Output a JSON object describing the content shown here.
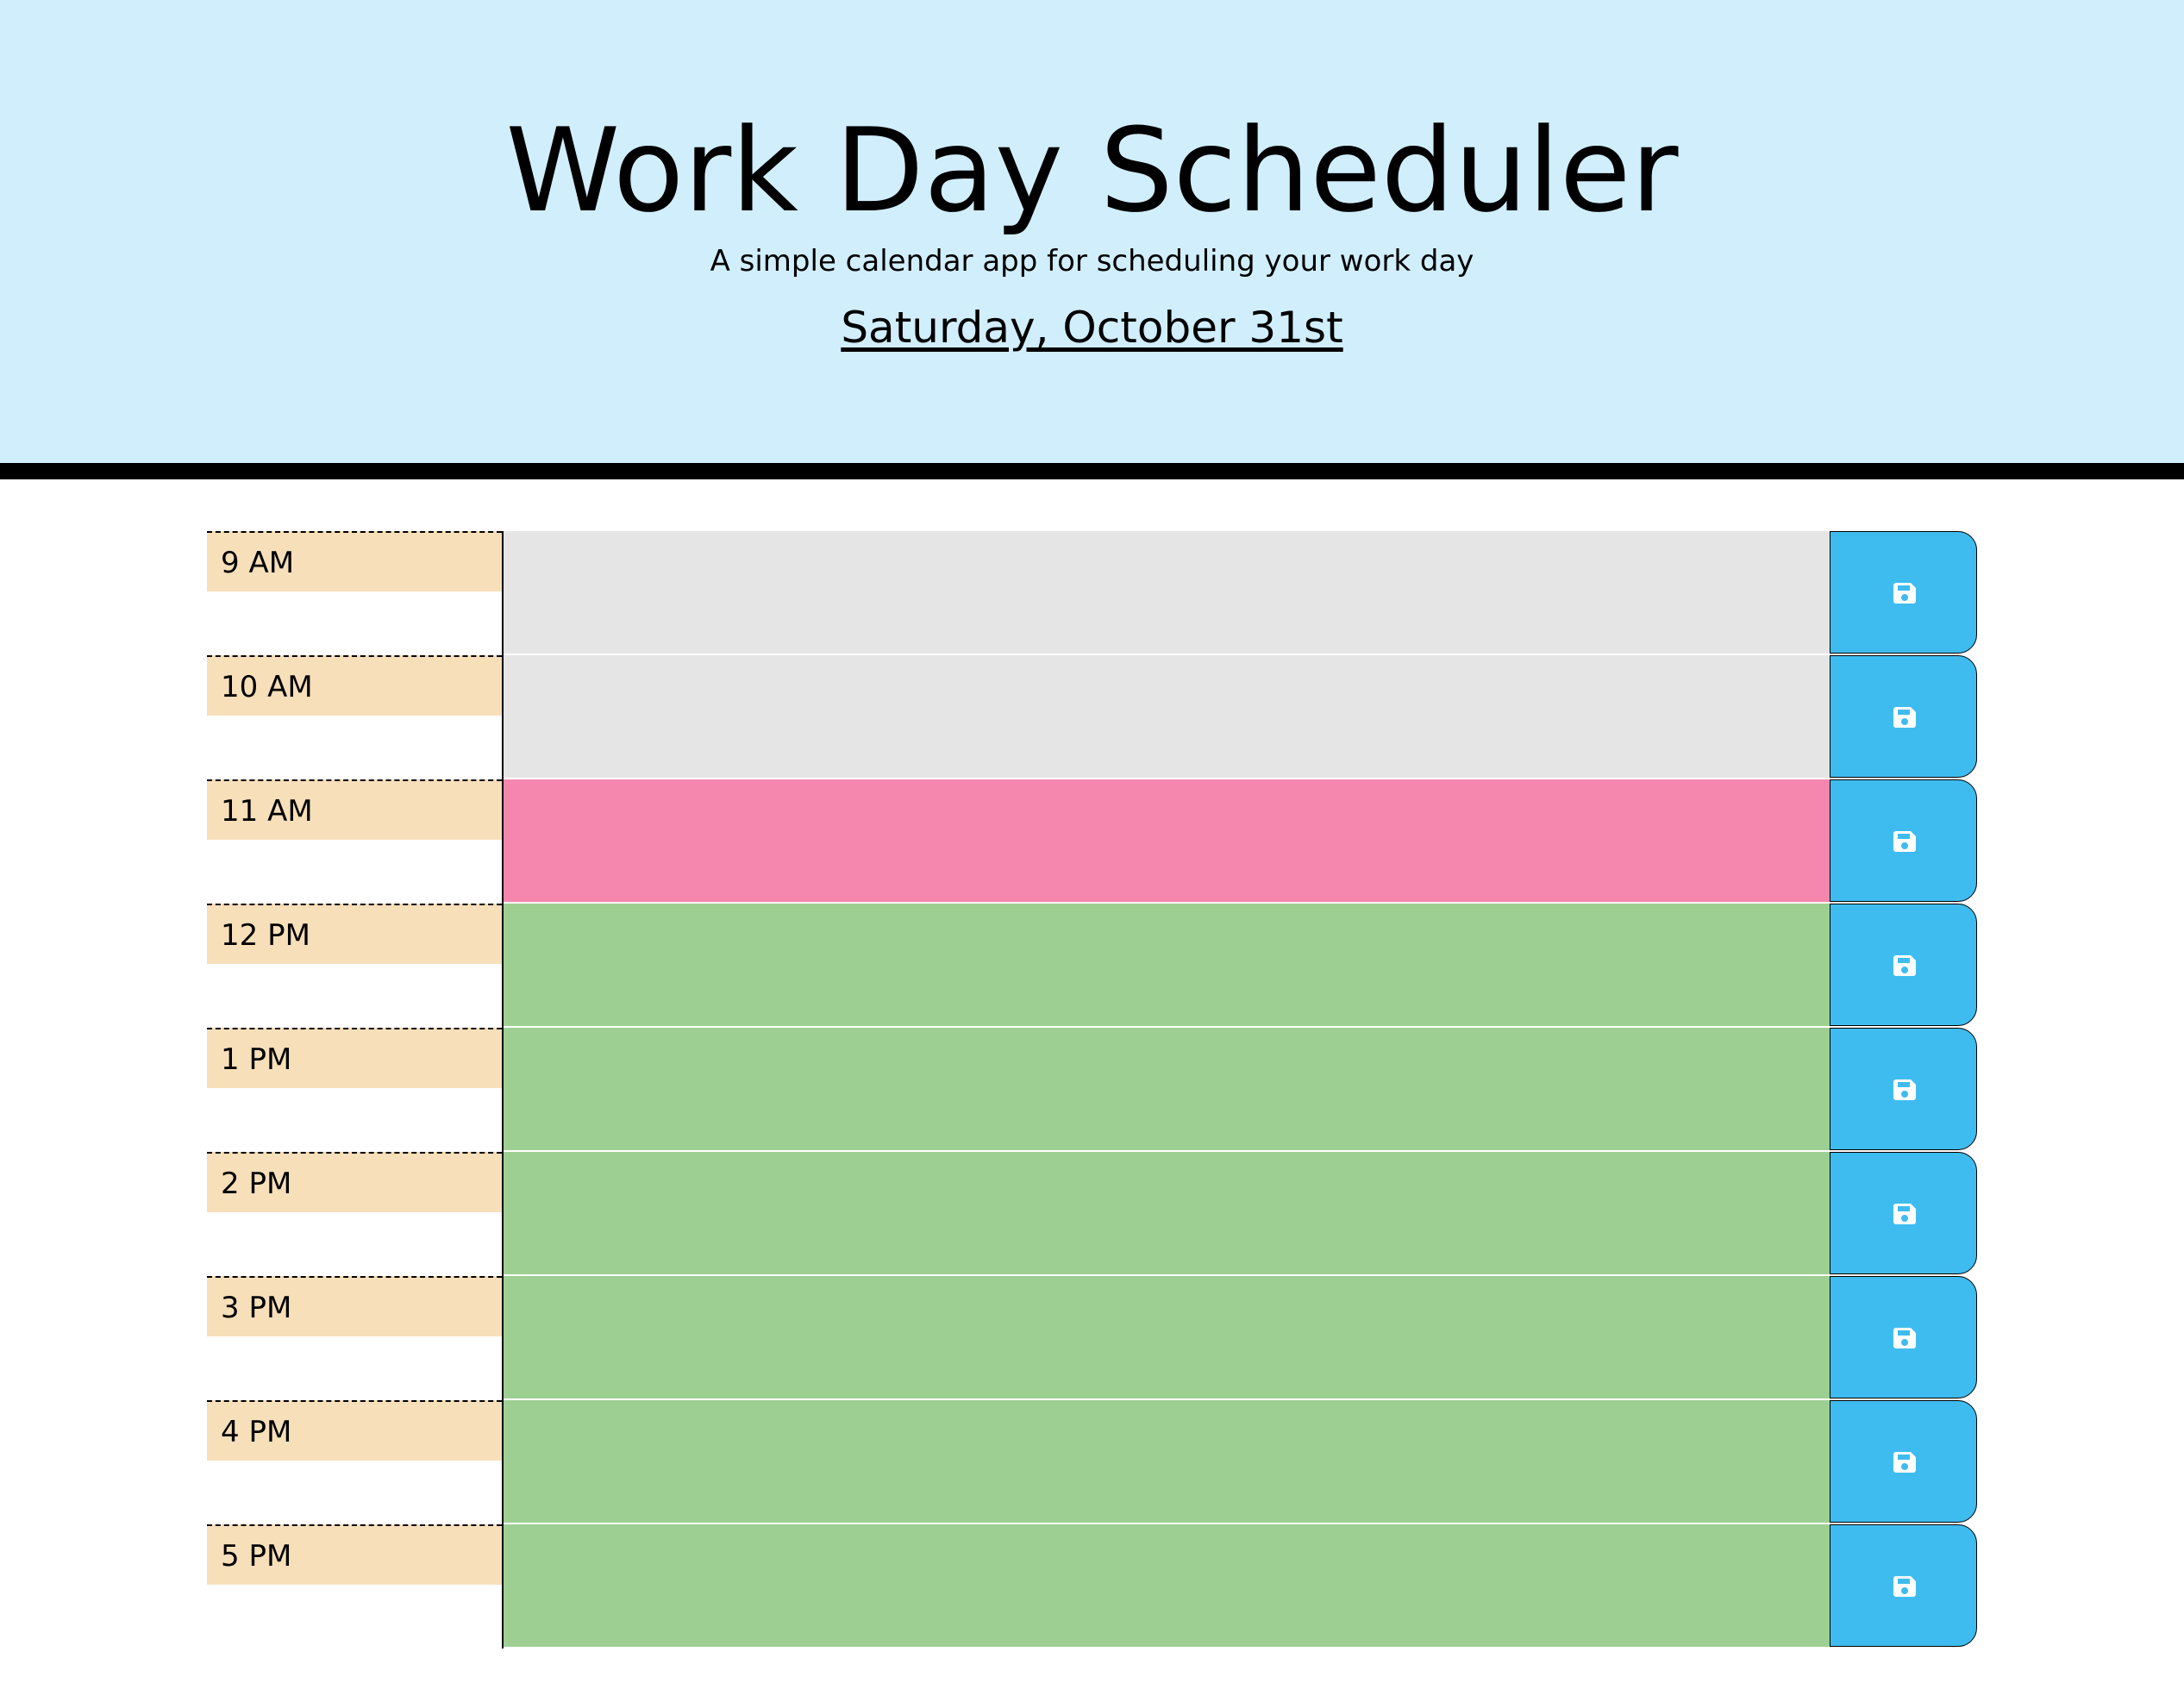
{
  "header": {
    "title": "Work Day Scheduler",
    "subtitle": "A simple calendar app for scheduling your work day",
    "current_day": "Saturday, October 31st"
  },
  "colors": {
    "past": "#e5e5e5",
    "present": "#f586ae",
    "future": "#9dcf92",
    "hour_label_bg": "#f7dfba",
    "save_button": "#3fbcef",
    "header_bg": "#d1eefd"
  },
  "time_blocks": [
    {
      "hour": "9 AM",
      "status": "past",
      "description": "",
      "save_icon": "save-icon"
    },
    {
      "hour": "10 AM",
      "status": "past",
      "description": "",
      "save_icon": "save-icon"
    },
    {
      "hour": "11 AM",
      "status": "present",
      "description": "",
      "save_icon": "save-icon"
    },
    {
      "hour": "12 PM",
      "status": "future",
      "description": "",
      "save_icon": "save-icon"
    },
    {
      "hour": "1 PM",
      "status": "future",
      "description": "",
      "save_icon": "save-icon"
    },
    {
      "hour": "2 PM",
      "status": "future",
      "description": "",
      "save_icon": "save-icon"
    },
    {
      "hour": "3 PM",
      "status": "future",
      "description": "",
      "save_icon": "save-icon"
    },
    {
      "hour": "4 PM",
      "status": "future",
      "description": "",
      "save_icon": "save-icon"
    },
    {
      "hour": "5 PM",
      "status": "future",
      "description": "",
      "save_icon": "save-icon"
    }
  ]
}
